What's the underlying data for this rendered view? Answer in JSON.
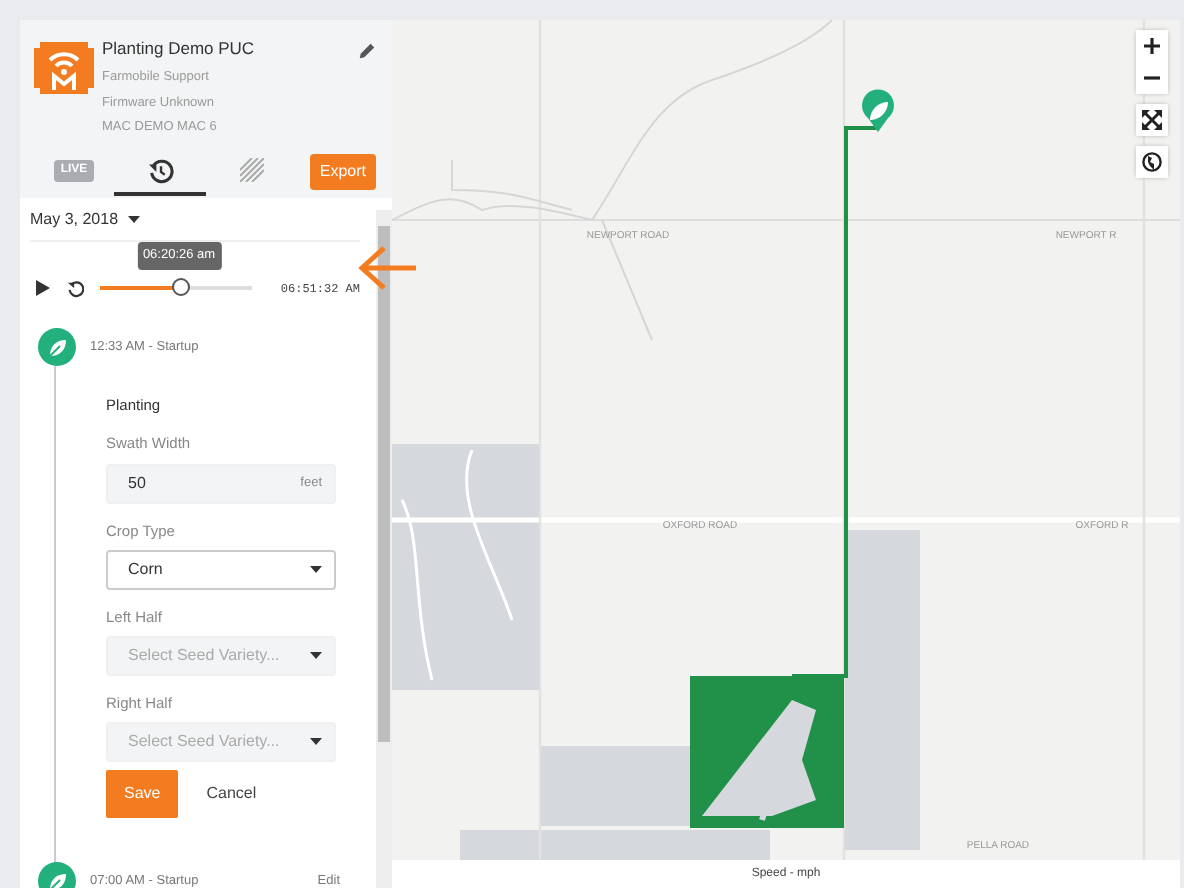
{
  "device": {
    "name": "Planting Demo PUC",
    "owner": "Farmobile Support",
    "firmware": "Firmware Unknown",
    "mac": "MAC DEMO MAC 6"
  },
  "tabs": [
    {
      "kind": "live",
      "label": "LIVE",
      "selected": false
    },
    {
      "kind": "history",
      "selected": true
    },
    {
      "kind": "pattern",
      "selected": false
    }
  ],
  "export_button": "Export",
  "date": "May 3, 2018",
  "playback": {
    "tooltip": "06:20:26 am",
    "level": 0.52,
    "end_time": "06:51:32 AM"
  },
  "events": [
    {
      "time": "12:33 AM - Startup",
      "form": {
        "title": "Planting",
        "fields": [
          {
            "kind": "input",
            "label": "Swath Width",
            "value": "50",
            "unit": "feet"
          },
          {
            "kind": "select",
            "label": "Crop Type",
            "value": "Corn"
          },
          {
            "kind": "select",
            "label": "Left Half",
            "placeholder": "Select Seed Variety..."
          },
          {
            "kind": "select",
            "label": "Right Half",
            "placeholder": "Select Seed Variety..."
          }
        ],
        "save": "Save",
        "cancel": "Cancel"
      }
    },
    {
      "time": "07:00 AM - Startup",
      "action": "Edit"
    }
  ],
  "map": {
    "road_labels": [
      "NEWPORT ROAD",
      "NEWPORT R",
      "OXFORD ROAD",
      "OXFORD R",
      "PELLA ROAD"
    ],
    "legend": "Speed - mph"
  }
}
